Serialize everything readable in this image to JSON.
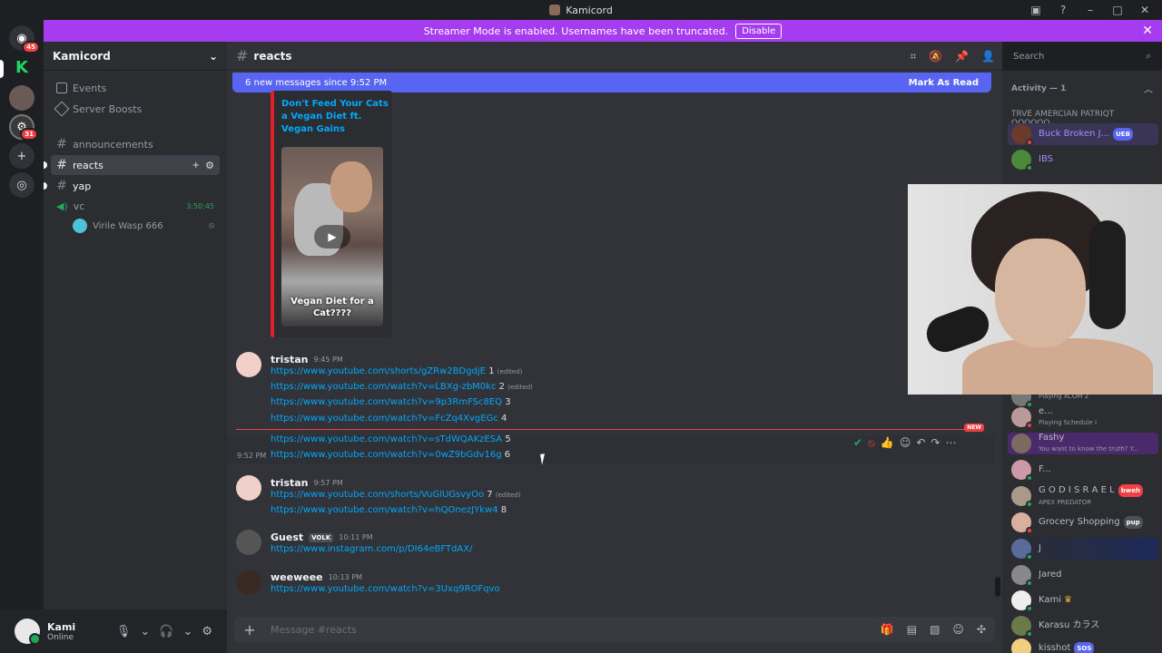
{
  "window": {
    "title": "Kamicord"
  },
  "rail": {
    "badge_top": "45",
    "badge_bottom": "31"
  },
  "banner": {
    "text": "Streamer Mode is enabled. Usernames have been truncated.",
    "button": "Disable"
  },
  "guild": {
    "name": "Kamicord",
    "items": [
      {
        "label": "Events"
      },
      {
        "label": "Server Boosts"
      },
      {
        "label": "announcements"
      },
      {
        "label": "reacts"
      },
      {
        "label": "yap"
      },
      {
        "label": "vc",
        "time": "3:50:45"
      },
      {
        "label": "Virile Wasp 666"
      }
    ]
  },
  "user": {
    "name": "Kami",
    "status": "Online"
  },
  "channel": {
    "name": "reacts",
    "search_placeholder": "Search"
  },
  "newbar": {
    "left": "6 new messages since 9:52 PM",
    "right": "Mark As Read"
  },
  "embed": {
    "title": "Don't Feed Your Cats a Vegan Diet ft. Vegan Gains",
    "caption": "Vegan Diet for a Cat????"
  },
  "messages": [
    {
      "author": "tristan",
      "time": "9:45 PM",
      "lines": [
        {
          "url": "https://www.youtube.com/shorts/gZRw2BDgdjE",
          "suffix": "1",
          "edited": "(edited)"
        },
        {
          "url": "https://www.youtube.com/watch?v=LBXg-zbM0kc",
          "suffix": "2",
          "edited": "(edited)"
        },
        {
          "url": "https://www.youtube.com/watch?v=9p3RmFSc8EQ",
          "suffix": "3",
          "edited": ""
        },
        {
          "url": "https://www.youtube.com/watch?v=FcZq4XvgEGc",
          "suffix": "4",
          "edited": ""
        },
        {
          "url": "https://www.youtube.com/watch?v=sTdWQAKzESA",
          "suffix": "5",
          "edited": ""
        },
        {
          "url": "https://www.youtube.com/watch?v=0wZ9bGdv16g",
          "suffix": "6",
          "edited": "",
          "stamp": "9:52 PM"
        }
      ]
    },
    {
      "author": "tristan",
      "time": "9:57 PM",
      "lines": [
        {
          "url": "https://www.youtube.com/shorts/VuGlUGsvyOo",
          "suffix": "7",
          "edited": "(edited)"
        },
        {
          "url": "https://www.youtube.com/watch?v=hQOnezJYkw4",
          "suffix": "8",
          "edited": ""
        }
      ]
    },
    {
      "author": "Guest",
      "tag": "VOLK",
      "time": "10:11 PM",
      "lines": [
        {
          "url": "https://www.instagram.com/p/DI64eBFTdAX/",
          "suffix": "",
          "edited": ""
        }
      ]
    },
    {
      "author": "weeweee",
      "time": "10:13 PM",
      "lines": [
        {
          "url": "https://www.youtube.com/watch?v=3Uxq9ROFqvo",
          "suffix": "",
          "edited": ""
        }
      ]
    }
  ],
  "new_label": "NEW",
  "composer": {
    "placeholder": "Message #reacts"
  },
  "members": {
    "activity": "Activity — 1",
    "group": "TRVE AMERCIAN PATRIQT QQQQQQ...",
    "list": [
      {
        "name": "Buck Broken J...",
        "badge": "UEB",
        "sub": "",
        "color": "#a58cff"
      },
      {
        "name": "IBS",
        "badge": "",
        "sub": "",
        "color": "#a58cff"
      },
      {
        "name": "",
        "badge": "",
        "sub": "Playing XCOM 2",
        "color": "#b5bac1"
      },
      {
        "name": "e...",
        "badge": "",
        "sub": "Playing Schedule I",
        "color": "#b5bac1"
      },
      {
        "name": "Fashy",
        "badge": "",
        "sub": "You want to know the truth? Y...",
        "color": "#b5bac1"
      },
      {
        "name": "F...",
        "badge": "",
        "sub": "",
        "color": "#b5bac1"
      },
      {
        "name": "G O D I S R A E L",
        "badge": "bweh",
        "sub": "APEX PREDATOR",
        "color": "#b5bac1"
      },
      {
        "name": "Grocery Shopping",
        "badge": "pup",
        "sub": "",
        "color": "#b5bac1"
      },
      {
        "name": "J",
        "badge": "",
        "sub": "",
        "color": "#b5bac1"
      },
      {
        "name": "Jared",
        "badge": "",
        "sub": "",
        "color": "#b5bac1"
      },
      {
        "name": "Kami",
        "badge": "",
        "sub": "",
        "color": "#b5bac1"
      },
      {
        "name": "Karasu カラス",
        "badge": "",
        "sub": "",
        "color": "#b5bac1"
      },
      {
        "name": "kisshot",
        "badge": "SOS",
        "sub": "",
        "color": "#b5bac1"
      }
    ]
  },
  "colors": {
    "accent": "#5865f2",
    "banner": "#a63cf0",
    "link": "#00a8fc",
    "danger": "#f23f43",
    "online": "#23a55a"
  }
}
